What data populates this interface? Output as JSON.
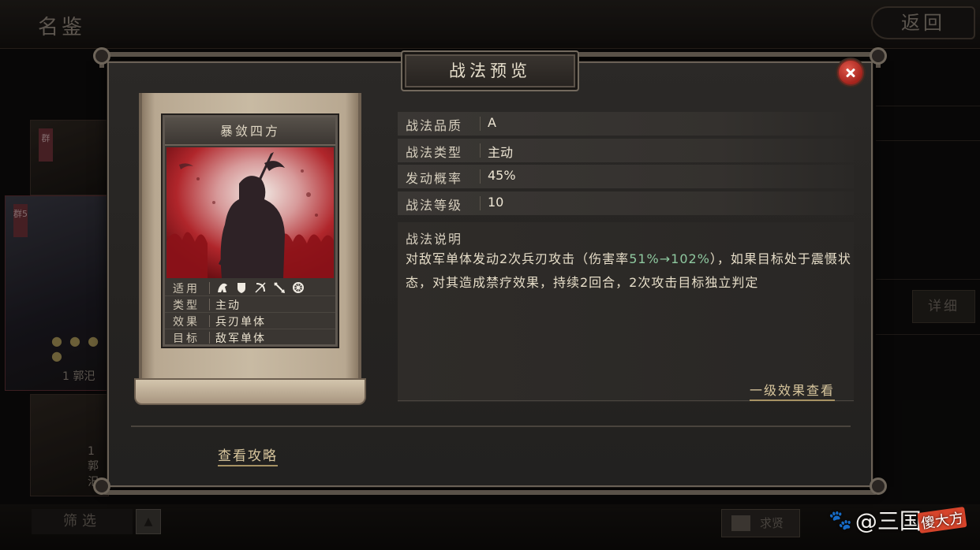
{
  "background": {
    "page_title": "名鉴",
    "back_label": "返回",
    "detail_label": "详细",
    "filter_label": "筛选",
    "seek_label": "求贤",
    "card_levels": [
      "1 郭汜",
      "1 郭汜"
    ],
    "card_badges": [
      "群",
      "群5"
    ]
  },
  "modal": {
    "title": "战法预览",
    "skill_card": {
      "name": "暴敛四方",
      "stats": [
        {
          "key": "适用",
          "value": ""
        },
        {
          "key": "类型",
          "value": "主动"
        },
        {
          "key": "效果",
          "value": "兵刃单体"
        },
        {
          "key": "目标",
          "value": "敌军单体"
        }
      ],
      "troop_icons": [
        "cavalry-icon",
        "shield-icon",
        "bow-icon",
        "spear-icon",
        "siege-icon"
      ]
    },
    "info": [
      {
        "label": "战法品质",
        "value": "A"
      },
      {
        "label": "战法类型",
        "value": "主动"
      },
      {
        "label": "发动概率",
        "value": "45%"
      },
      {
        "label": "战法等级",
        "value": "10"
      }
    ],
    "description": {
      "title": "战法说明",
      "text_before": "对敌军单体发动2次兵刃攻击（伤害率",
      "text_highlight": "51%→102%",
      "text_after": "），如果目标处于震慑状态，对其造成禁疗效果，持续2回合，2次攻击目标独立判定",
      "highlight_color": "#8fc9a0"
    },
    "level1_link": "一级效果查看",
    "guide_link": "查看攻略"
  },
  "watermark": {
    "text": "@三国",
    "badge": "傻大方"
  },
  "colors": {
    "accent_gold": "#d9c79e",
    "close_red": "#c33a2e"
  }
}
